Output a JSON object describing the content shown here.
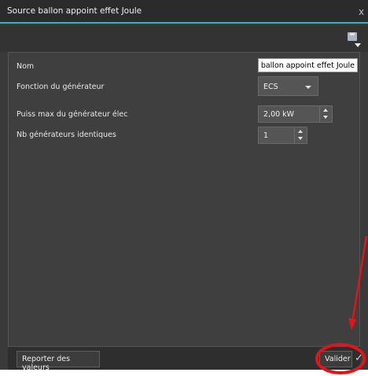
{
  "window": {
    "title": "Source ballon appoint effet Joule",
    "close_glyph": "x"
  },
  "toolbar": {
    "save_icon": "save-icon",
    "dropdown_icon": "chevron-down-icon"
  },
  "form": {
    "nom": {
      "label": "Nom",
      "value": "e ballon appoint effet Joule"
    },
    "fonction": {
      "label": "Fonction du générateur",
      "value": "ECS"
    },
    "puissance": {
      "label": "Puiss max du générateur élec",
      "value": "2,00 kW"
    },
    "nb": {
      "label": "Nb générateurs identiques",
      "value": "1"
    }
  },
  "footer": {
    "report_label": "Reporter des valeurs",
    "validate_label": "Valider",
    "check_glyph": "✓"
  },
  "annotation": {
    "color": "#e0141b"
  }
}
